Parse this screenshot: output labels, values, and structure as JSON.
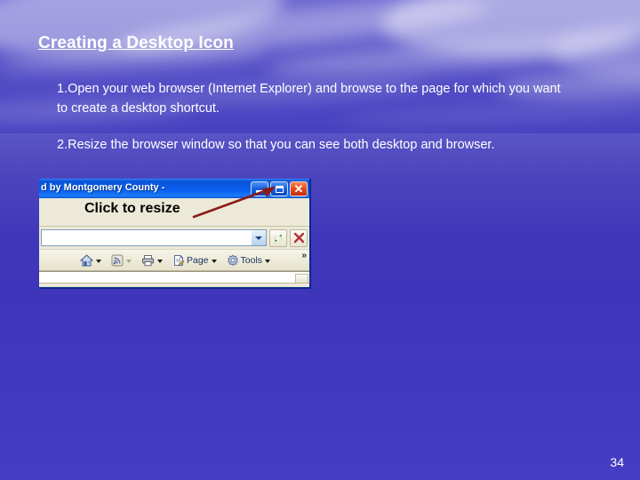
{
  "slide": {
    "title": "Creating a Desktop Icon",
    "bullets": [
      "1.Open your web browser (Internet Explorer) and browse to the page for which you want to create a desktop shortcut.",
      "2.Resize the browser window so that you can see both desktop and browser."
    ],
    "page_number": "34",
    "colors": {
      "background_top": "#6a63cf",
      "background_bottom": "#4038bd",
      "text": "#ffffff",
      "annotation_arrow": "#8b1a16",
      "titlebar_blue": "#0a5ae8",
      "close_button_red": "#e2511d"
    }
  },
  "browser_screenshot": {
    "titlebar": {
      "title": "d by Montgomery County -",
      "buttons": [
        {
          "name": "minimize",
          "glyph": "minimize-icon"
        },
        {
          "name": "restore",
          "glyph": "restore-icon"
        },
        {
          "name": "close",
          "glyph": "close-icon",
          "label": "✕"
        }
      ]
    },
    "annotation": {
      "text": "Click to resize",
      "arrow": "points to restore button"
    },
    "address_bar": {
      "value": "",
      "placeholder": "",
      "dropdown_icon": "chevron-down-icon",
      "refresh_icon": "refresh-icon",
      "stop_icon": "stop-icon"
    },
    "command_bar": {
      "items": [
        {
          "icon": "home-icon",
          "label": "",
          "has_caret": true,
          "caret_dim": false
        },
        {
          "icon": "rss-feed-icon",
          "label": "",
          "has_caret": true,
          "caret_dim": true
        },
        {
          "icon": "print-icon",
          "label": "",
          "has_caret": true,
          "caret_dim": false
        },
        {
          "icon": "page-icon",
          "label": "Page",
          "has_caret": true,
          "caret_dim": false
        },
        {
          "icon": "tools-gear-icon",
          "label": "Tools",
          "has_caret": true,
          "caret_dim": false
        }
      ],
      "overflow": "»"
    }
  }
}
